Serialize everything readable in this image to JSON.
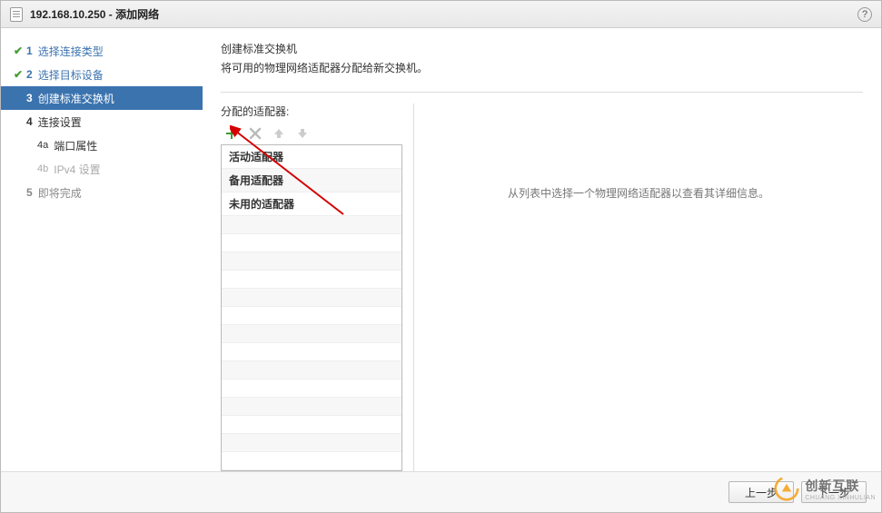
{
  "title": "192.168.10.250 - 添加网络",
  "help_tooltip": "帮助",
  "steps": {
    "s1": {
      "num": "1",
      "label": "选择连接类型"
    },
    "s2": {
      "num": "2",
      "label": "选择目标设备"
    },
    "s3": {
      "num": "3",
      "label": "创建标准交换机"
    },
    "s4": {
      "num": "4",
      "label": "连接设置"
    },
    "s4a": {
      "num": "4a",
      "label": "端口属性"
    },
    "s4b": {
      "num": "4b",
      "label": "IPv4 设置"
    },
    "s5": {
      "num": "5",
      "label": "即将完成"
    }
  },
  "main": {
    "heading": "创建标准交换机",
    "subheading": "将可用的物理网络适配器分配给新交换机。",
    "assigned_label": "分配的适配器:",
    "groups": {
      "active": "活动适配器",
      "standby": "备用适配器",
      "unused": "未用的适配器"
    },
    "placeholder": "从列表中选择一个物理网络适配器以查看其详细信息。"
  },
  "toolbar": {
    "add": "add-icon",
    "remove": "remove-icon",
    "up": "up-icon",
    "down": "down-icon"
  },
  "buttons": {
    "back": "上一步",
    "next": "下一步"
  },
  "watermark": {
    "text": "创新互联",
    "sub": "CHUANG XINHULIAN"
  }
}
